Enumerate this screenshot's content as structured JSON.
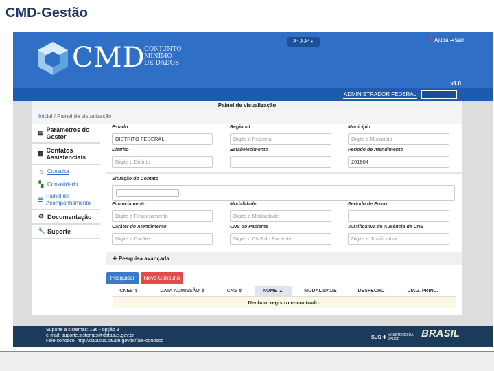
{
  "slide": {
    "title": "CMD-Gestão"
  },
  "header": {
    "cmd": "CMD",
    "subtitle": [
      "CONJUNTO",
      "MÍNIMO",
      "DE DADOS"
    ],
    "accessibility": "A⁻ A A⁺ ◐",
    "help": "Ajuda",
    "exit": "Sair",
    "version": "v1.0",
    "user": "ADMINISTRADOR FEDERAL"
  },
  "panel": {
    "title": "Painel de visualização",
    "breadcrumb": {
      "home": "Inicial",
      "sep": "/",
      "current": "Painel de visualização"
    }
  },
  "sidebar": {
    "items": [
      {
        "label": "Parâmetros do Gestor",
        "icon": "list-icon"
      },
      {
        "label": "Contatos Assistenciais",
        "icon": "calendar-icon"
      },
      {
        "label": "Consulta",
        "icon": "home-icon"
      },
      {
        "label": "Consolidado",
        "icon": "grid-icon"
      },
      {
        "label": "Painel de Acompanhamento",
        "icon": "sliders-icon"
      },
      {
        "label": "Documentação",
        "icon": "gear-icon"
      },
      {
        "label": "Suporte",
        "icon": "wrench-icon"
      }
    ]
  },
  "form": {
    "estado": {
      "label": "Estado",
      "value": "DISTRITO FEDERAL"
    },
    "regional": {
      "label": "Regional",
      "placeholder": "Digite a Regional"
    },
    "municipio": {
      "label": "Município",
      "placeholder": "Digite o Município"
    },
    "distrito": {
      "label": "Distrito",
      "placeholder": "Digite o Distrito"
    },
    "estabelecimento": {
      "label": "Estabelecimento",
      "placeholder": ""
    },
    "periodo_atendimento": {
      "label": "Período de Atendimento",
      "value": "201804"
    },
    "situacao": {
      "label": "Situação do Contato"
    },
    "financiamento": {
      "label": "Financiamento",
      "placeholder": "Digite o Financiamento"
    },
    "modalidade": {
      "label": "Modalidade",
      "placeholder": "Digite a Modalidade"
    },
    "periodo_envio": {
      "label": "Período de Envio",
      "placeholder": ""
    },
    "carater": {
      "label": "Caráter do Atendimento",
      "placeholder": "Digite a Caráter"
    },
    "cns": {
      "label": "CNS do Paciente",
      "placeholder": "Digite o CNS do Paciente"
    },
    "justificativa": {
      "label": "Justificativa de Ausência de CNS",
      "placeholder": "Digite a Justificativa"
    }
  },
  "advanced": "Pesquisa avançada",
  "buttons": {
    "search": "Pesquisar",
    "new": "Nova Consulta"
  },
  "table": {
    "headers": [
      "CNES ⇕",
      "DATA ADMISSÃO ⇕",
      "CNS ⇕",
      "NOME ▲",
      "MODALIDADE",
      "DESFECHO",
      "DIAG. PRINC."
    ],
    "empty": "Nenhum registro encontrado."
  },
  "footer": {
    "lines": [
      "Suporte a sistemas: 136 - opção 8",
      "e-mail: suporte.sistemas@datasus.gov.br",
      "Fale conosco: http://datasus.saude.gov.br/fale-conosco"
    ],
    "ministry": "MINISTÉRIO DA SAÚDE",
    "sus": "SUS",
    "brasil": "BRASIL"
  }
}
